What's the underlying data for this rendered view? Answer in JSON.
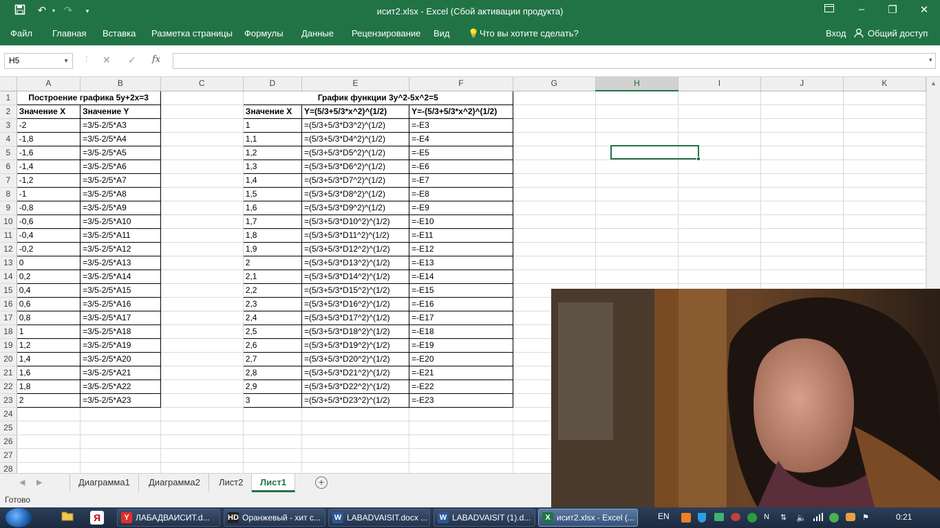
{
  "window": {
    "title": "исит2.xlsx - Excel (Сбой активации продукта)",
    "qat": {
      "save_icon": "save-icon",
      "undo_icon": "undo-icon",
      "redo_icon": "redo-icon",
      "customize_icon": "chevron-down-icon"
    },
    "controls": {
      "restore_ribbon": "ribbon-display-icon",
      "minimize": "–",
      "maximize": "❐",
      "close": "✕"
    }
  },
  "ribbon": {
    "tabs": [
      "Файл",
      "Главная",
      "Вставка",
      "Разметка страницы",
      "Формулы",
      "Данные",
      "Рецензирование",
      "Вид"
    ],
    "tell_me": "Что вы хотите сделать?",
    "signin": "Вход",
    "share": "Общий доступ"
  },
  "formula_bar": {
    "name_box": "H5",
    "cancel_icon": "✕",
    "enter_icon": "✓",
    "fx_label": "fx",
    "formula": ""
  },
  "sheet": {
    "columns": [
      "A",
      "B",
      "C",
      "D",
      "E",
      "F",
      "G",
      "H",
      "I",
      "J",
      "K"
    ],
    "selected_column": "H",
    "selected_cell": "H5",
    "title_1": "Построение графика 5y+2x=3",
    "title_2": "График функции 3y^2-5x^2=5",
    "headers": {
      "A": "Значение X",
      "B": "Значение Y",
      "D": "Значение X",
      "E": "Y=(5/3+5/3*x^2)^(1/2)",
      "F": "Y=-(5/3+5/3*x^2)^(1/2)"
    },
    "rows": [
      {
        "n": "1"
      },
      {
        "n": "2"
      },
      {
        "n": "3",
        "A": "-2",
        "B": "=3/5-2/5*A3",
        "D": "1",
        "E": "=(5/3+5/3*D3^2)^(1/2)",
        "F": "=-E3"
      },
      {
        "n": "4",
        "A": "-1,8",
        "B": "=3/5-2/5*A4",
        "D": "1,1",
        "E": "=(5/3+5/3*D4^2)^(1/2)",
        "F": "=-E4"
      },
      {
        "n": "5",
        "A": "-1,6",
        "B": "=3/5-2/5*A5",
        "D": "1,2",
        "E": "=(5/3+5/3*D5^2)^(1/2)",
        "F": "=-E5"
      },
      {
        "n": "6",
        "A": "-1,4",
        "B": "=3/5-2/5*A6",
        "D": "1,3",
        "E": "=(5/3+5/3*D6^2)^(1/2)",
        "F": "=-E6"
      },
      {
        "n": "7",
        "A": "-1,2",
        "B": "=3/5-2/5*A7",
        "D": "1,4",
        "E": "=(5/3+5/3*D7^2)^(1/2)",
        "F": "=-E7"
      },
      {
        "n": "8",
        "A": "-1",
        "B": "=3/5-2/5*A8",
        "D": "1,5",
        "E": "=(5/3+5/3*D8^2)^(1/2)",
        "F": "=-E8"
      },
      {
        "n": "9",
        "A": "-0,8",
        "B": "=3/5-2/5*A9",
        "D": "1,6",
        "E": "=(5/3+5/3*D9^2)^(1/2)",
        "F": "=-E9"
      },
      {
        "n": "10",
        "A": "-0,6",
        "B": "=3/5-2/5*A10",
        "D": "1,7",
        "E": "=(5/3+5/3*D10^2)^(1/2)",
        "F": "=-E10"
      },
      {
        "n": "11",
        "A": "-0,4",
        "B": "=3/5-2/5*A11",
        "D": "1,8",
        "E": "=(5/3+5/3*D11^2)^(1/2)",
        "F": "=-E11"
      },
      {
        "n": "12",
        "A": "-0,2",
        "B": "=3/5-2/5*A12",
        "D": "1,9",
        "E": "=(5/3+5/3*D12^2)^(1/2)",
        "F": "=-E12"
      },
      {
        "n": "13",
        "A": "0",
        "B": "=3/5-2/5*A13",
        "D": "2",
        "E": "=(5/3+5/3*D13^2)^(1/2)",
        "F": "=-E13"
      },
      {
        "n": "14",
        "A": "0,2",
        "B": "=3/5-2/5*A14",
        "D": "2,1",
        "E": "=(5/3+5/3*D14^2)^(1/2)",
        "F": "=-E14"
      },
      {
        "n": "15",
        "A": "0,4",
        "B": "=3/5-2/5*A15",
        "D": "2,2",
        "E": "=(5/3+5/3*D15^2)^(1/2)",
        "F": "=-E15"
      },
      {
        "n": "16",
        "A": "0,6",
        "B": "=3/5-2/5*A16",
        "D": "2,3",
        "E": "=(5/3+5/3*D16^2)^(1/2)",
        "F": "=-E16"
      },
      {
        "n": "17",
        "A": "0,8",
        "B": "=3/5-2/5*A17",
        "D": "2,4",
        "E": "=(5/3+5/3*D17^2)^(1/2)",
        "F": "=-E17"
      },
      {
        "n": "18",
        "A": "1",
        "B": "=3/5-2/5*A18",
        "D": "2,5",
        "E": "=(5/3+5/3*D18^2)^(1/2)",
        "F": "=-E18"
      },
      {
        "n": "19",
        "A": "1,2",
        "B": "=3/5-2/5*A19",
        "D": "2,6",
        "E": "=(5/3+5/3*D19^2)^(1/2)",
        "F": "=-E19"
      },
      {
        "n": "20",
        "A": "1,4",
        "B": "=3/5-2/5*A20",
        "D": "2,7",
        "E": "=(5/3+5/3*D20^2)^(1/2)",
        "F": "=-E20"
      },
      {
        "n": "21",
        "A": "1,6",
        "B": "=3/5-2/5*A21",
        "D": "2,8",
        "E": "=(5/3+5/3*D21^2)^(1/2)",
        "F": "=-E21"
      },
      {
        "n": "22",
        "A": "1,8",
        "B": "=3/5-2/5*A22",
        "D": "2,9",
        "E": "=(5/3+5/3*D22^2)^(1/2)",
        "F": "=-E22"
      },
      {
        "n": "23",
        "A": "2",
        "B": "=3/5-2/5*A23",
        "D": "3",
        "E": "=(5/3+5/3*D23^2)^(1/2)",
        "F": "=-E23"
      },
      {
        "n": "24"
      },
      {
        "n": "25"
      },
      {
        "n": "26"
      },
      {
        "n": "27"
      },
      {
        "n": "28"
      }
    ]
  },
  "sheet_tabs": [
    "Диаграмма1",
    "Диаграмма2",
    "Лист2",
    "Лист1"
  ],
  "active_sheet_tab": "Лист1",
  "status_bar": {
    "text": "Готово"
  },
  "taskbar": {
    "buttons": [
      {
        "icon": "Y",
        "label": "ЛАБАДВАИСИТ.d..."
      },
      {
        "icon": "HD",
        "label": "Оранжевый - хит с..."
      },
      {
        "icon": "W",
        "label": "LABADVAISIT.docx ..."
      },
      {
        "icon": "W",
        "label": "LABADVAISIT (1).d..."
      },
      {
        "icon": "X",
        "label": "исит2.xlsx - Excel (..."
      }
    ],
    "language": "EN",
    "clock": "0:21"
  },
  "colors": {
    "excel_green": "#217346",
    "taskbar": "#1b2a3f"
  }
}
